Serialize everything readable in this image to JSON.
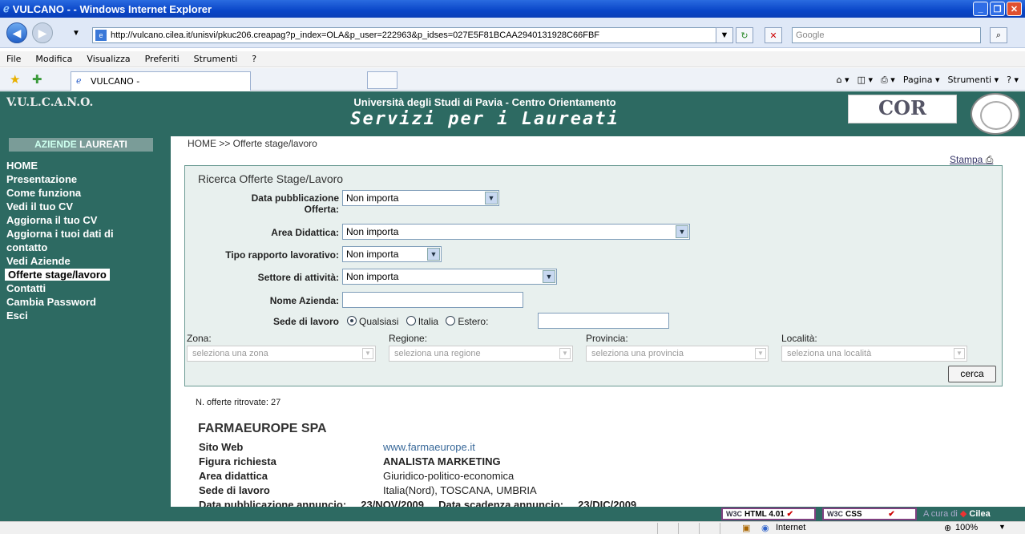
{
  "window": {
    "title": "VULCANO - - Windows Internet Explorer"
  },
  "browser": {
    "url": "http://vulcano.cilea.it/unisvi/pkuc206.creapag?p_index=OLA&p_user=222963&p_idses=027E5F81BCAA2940131928C66FBF",
    "search_placeholder": "Google",
    "menu": [
      "File",
      "Modifica",
      "Visualizza",
      "Preferiti",
      "Strumenti",
      "?"
    ],
    "tab_label": "VULCANO -",
    "tools": [
      "Pagina ▾",
      "Strumenti ▾"
    ]
  },
  "header": {
    "logo": "V.U.L.C.A.N.O.",
    "university": "Università degli Studi di Pavia - Centro Orientamento",
    "service": "Servizi per i Laureati",
    "cor_logo": "COR"
  },
  "sidebar": {
    "title_a": "AZIENDE",
    "title_b": "LAUREATI",
    "items": [
      "HOME",
      "Presentazione",
      "Come funziona",
      "Vedi il tuo CV",
      "Aggiorna il tuo CV",
      "Aggiorna i tuoi dati di",
      "contatto",
      "Vedi Aziende",
      "Offerte stage/lavoro",
      "Contatti",
      "Cambia Password",
      "Esci"
    ]
  },
  "breadcrumb": "HOME >> Offerte stage/lavoro",
  "stampa": "Stampa",
  "search_form": {
    "title": "Ricerca Offerte Stage/Lavoro",
    "data_pubblicazione_label_1": "Data pubblicazione",
    "data_pubblicazione_label_2": "Offerta:",
    "data_pubblicazione_value": "Non importa",
    "area_label": "Area Didattica:",
    "area_value": "Non importa",
    "tipo_label": "Tipo rapporto lavorativo:",
    "tipo_value": "Non importa",
    "settore_label": "Settore di attività:",
    "settore_value": "Non importa",
    "nome_label": "Nome Azienda:",
    "sede_label": "Sede di lavoro",
    "sede_options": [
      "Qualsiasi",
      "Italia",
      "Estero:"
    ],
    "zona_label": "Zona:",
    "zona_value": "seleziona una zona",
    "regione_label": "Regione:",
    "regione_value": "seleziona una regione",
    "provincia_label": "Provincia:",
    "provincia_value": "seleziona una provincia",
    "localita_label": "Località:",
    "localita_value": "seleziona una località",
    "button": "cerca"
  },
  "results": {
    "count": "N. offerte ritrovate: 27",
    "company": "FARMAEUROPE SPA",
    "rows": [
      {
        "label": "Sito Web",
        "value": "www.farmaeurope.it"
      },
      {
        "label": "Figura richiesta",
        "value": "ANALISTA MARKETING"
      },
      {
        "label": "Area didattica",
        "value": "Giuridico-politico-economica"
      },
      {
        "label": "Sede di lavoro",
        "value": "Italia(Nord), TOSCANA, UMBRIA"
      }
    ],
    "partial_row": "Data pubblicazione annuncio:     23/NOV/2009     Data scadenza annuncio:     23/DIC/2009"
  },
  "footer": {
    "w3c_html": "HTML 4.01",
    "w3c_css": "CSS",
    "w3c_mark": "W3C",
    "credit_a": "A cura di",
    "credit_b": "Cilea"
  },
  "status": {
    "zone": "Internet",
    "zoom": "100%"
  }
}
